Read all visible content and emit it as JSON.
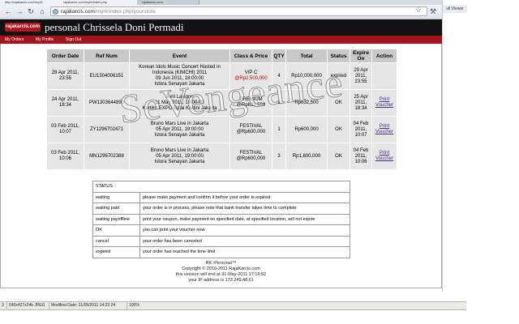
{
  "browser": {
    "tabs": [
      "http://rajakarcis.com/myrk/",
      "rajakarcis.com/myrk/index.php",
      "rajakarcis.com"
    ],
    "url_host": "rajakarcis.com",
    "url_path": "/myrk/index.php/yourstore",
    "side_label": "ull Viewer"
  },
  "site": {
    "logo": "rajakarcis.com",
    "title": "personal Chrissela Doni Permadi",
    "menu": [
      "My Orders",
      "My Profile",
      "Sign Out"
    ]
  },
  "orders": {
    "headers": [
      "Order Date",
      "Ref Num",
      "Event",
      "Class & Price",
      "QTY",
      "Total",
      "Status",
      "Expire On",
      "Action"
    ],
    "rows": [
      {
        "date": "28 Apr 2011, 23:55",
        "ref": "EU1304006151",
        "event": [
          "Korean Idols Music Concert Hosted in",
          "Indonesia (KIMCHI) 2011",
          "09 Jun 2011, 18:00:00",
          "Istora Senayan Jakarta"
        ],
        "class": "VIP C",
        "price": "@Rp2,500,000",
        "qty": "4",
        "total": "Rp10,000,000",
        "status": "expired",
        "expire": "29 Apr 2011, 23:55",
        "action": ""
      },
      {
        "date": "24 Apr 2011, 18:34",
        "ref": "PW1303644890",
        "event": [
          "Avril Lavigne",
          "11 May 2011, 19:00:00",
          "Kartika EXPO Balai Kartini Jakarta"
        ],
        "class": "PREMIUM",
        "price": "@Rp632,500",
        "qty": "1",
        "total": "Rp632,500",
        "status": "OK",
        "expire": "25 Apr 2011, 18:34",
        "action": "Print Voucher"
      },
      {
        "date": "03 Feb 2011, 10:07",
        "ref": "ZY1296702471",
        "event": [
          "Bruno Mars Live in Jakarta",
          "05 Apr 2011, 19:00:00",
          "Istora Senayan Jakarta"
        ],
        "class": "FESTIVAL",
        "price": "@Rp600,000",
        "qty": "1",
        "total": "Rp600,000",
        "status": "OK",
        "expire": "04 Feb 2011, 10:07",
        "action": "Print Voucher"
      },
      {
        "date": "03 Feb 2011, 10:06",
        "ref": "MN1296702388",
        "event": [
          "Bruno Mars Live in Jakarta",
          "05 Apr 2011, 19:00:00",
          "Istora Senayan Jakarta"
        ],
        "class": "FESTIVAL",
        "price": "@Rp600,000",
        "qty": "3",
        "total": "Rp1,800,000",
        "status": "OK",
        "expire": "04 Feb 2011, 10:06",
        "action": "Print Voucher"
      }
    ]
  },
  "status_legend": {
    "title": "STATUS",
    "rows": [
      [
        "waiting",
        "please make payment and confirm it before your order is expired"
      ],
      [
        "waiting paid",
        "your order is in process, please note that bank transfer takes time to complete"
      ],
      [
        "waiting payoffline",
        "print your coupon, make payment on specified date, at specified location, will not expire"
      ],
      [
        "OK",
        "you can print your voucher now"
      ],
      [
        "cancel",
        "your order has been canceled"
      ],
      [
        "expired",
        "your order has reached the time limit"
      ]
    ]
  },
  "footer": [
    "RK::Personal™",
    "Copyright © 2010-2011 RajaKarcis.com",
    "this session will end at 31-May-2011 17:19:52",
    "your IP address is 173.249.48.61"
  ],
  "watermark": "SeVengeance",
  "statusbar": [
    "3",
    "640x427x24b JPEG",
    "Modified Date: 31/05/2011 14:22:24",
    "100%"
  ]
}
